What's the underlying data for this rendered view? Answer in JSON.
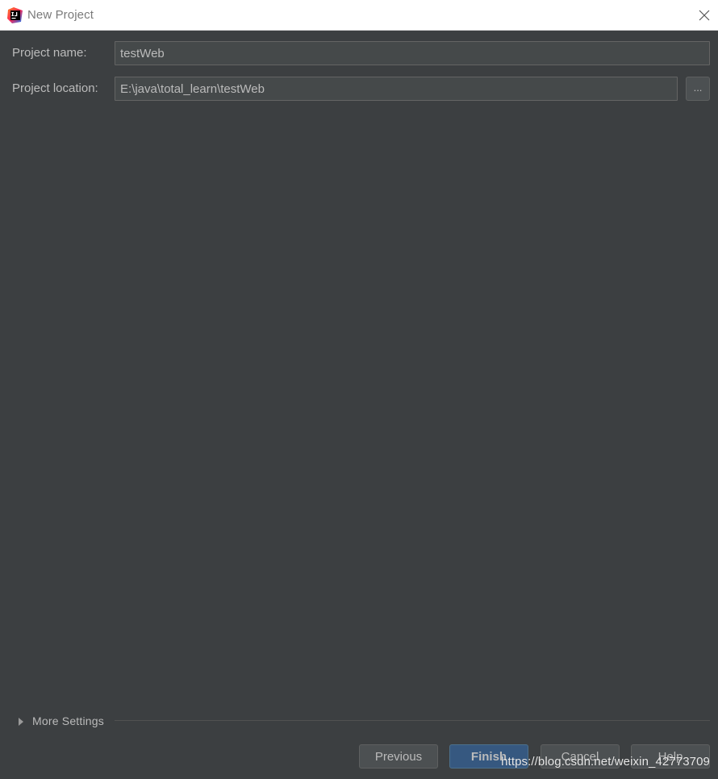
{
  "window": {
    "title": "New Project",
    "app_icon": "intellij-idea-icon",
    "close_icon": "close-icon"
  },
  "form": {
    "project_name_label": "Project name:",
    "project_name_value": "testWeb",
    "project_location_label": "Project location:",
    "project_location_value": "E:\\java\\total_learn\\testWeb",
    "browse_label": "..."
  },
  "more_settings": {
    "label": "More Settings",
    "expanded": false
  },
  "buttons": {
    "previous": "Previous",
    "finish": "Finish",
    "cancel": "Cancel",
    "help": "Help"
  },
  "watermark": "https://blog.csdn.net/weixin_42773709",
  "colors": {
    "background": "#3c3f41",
    "titlebar": "#ffffff",
    "field_background": "#45494a",
    "primary_button": "#365880",
    "text": "#bbbbbb"
  }
}
